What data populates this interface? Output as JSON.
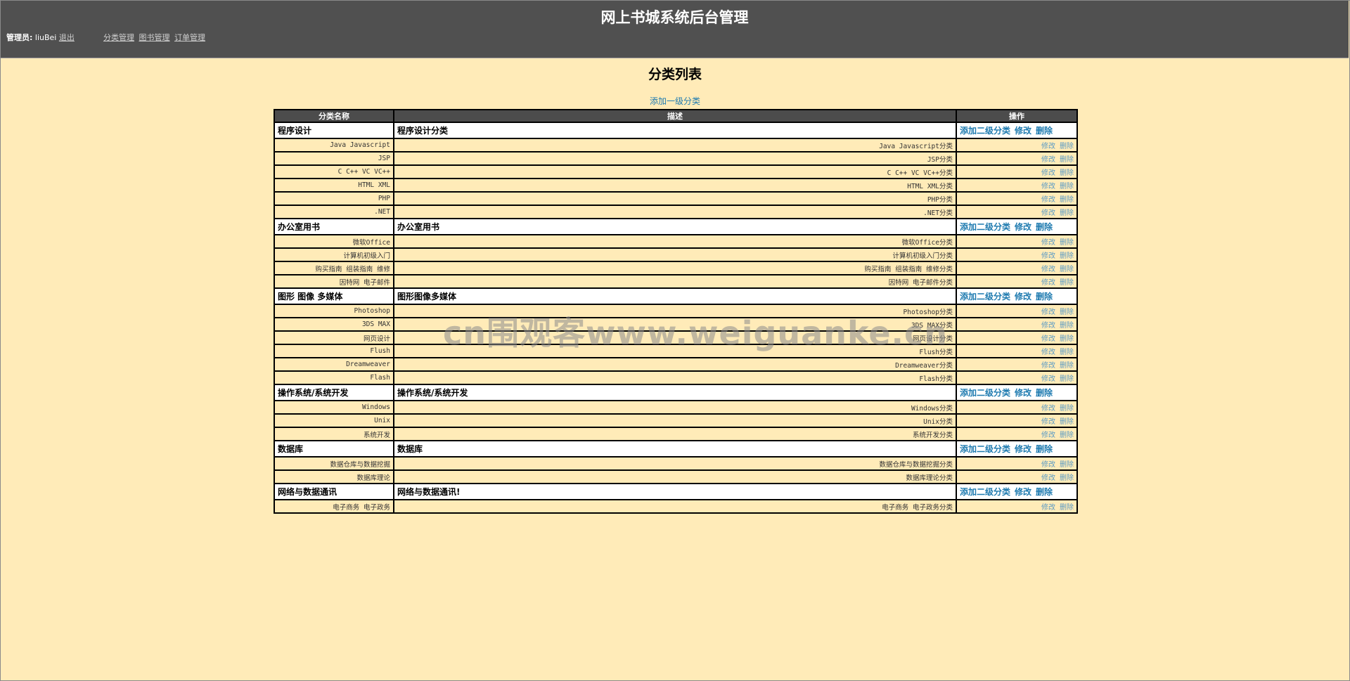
{
  "header": {
    "title": "网上书城系统后台管理",
    "admin_label": "管理员:",
    "admin_name": "liuBei",
    "logout": "退出",
    "nav": [
      "分类管理",
      "图书管理",
      "订单管理"
    ]
  },
  "page": {
    "title": "分类列表",
    "add_top": "添加一级分类"
  },
  "table": {
    "headers": [
      "分类名称",
      "描述",
      "操作"
    ],
    "ops_level1": [
      "添加二级分类",
      "修改",
      "删除"
    ],
    "ops_level2": [
      "修改",
      "删除"
    ],
    "groups": [
      {
        "name": "程序设计",
        "desc": "程序设计分类",
        "children": [
          {
            "name": "Java Javascript",
            "desc": "Java Javascript分类"
          },
          {
            "name": "JSP",
            "desc": "JSP分类"
          },
          {
            "name": "C C++ VC VC++",
            "desc": "C C++ VC VC++分类"
          },
          {
            "name": "HTML XML",
            "desc": "HTML XML分类"
          },
          {
            "name": "PHP",
            "desc": "PHP分类"
          },
          {
            "name": ".NET",
            "desc": ".NET分类"
          }
        ]
      },
      {
        "name": "办公室用书",
        "desc": "办公室用书",
        "children": [
          {
            "name": "微软Office",
            "desc": "微软Office分类"
          },
          {
            "name": "计算机初级入门",
            "desc": "计算机初级入门分类"
          },
          {
            "name": "购买指南 组装指南 维修",
            "desc": "购买指南 组装指南 维修分类"
          },
          {
            "name": "因特网 电子邮件",
            "desc": "因特网 电子邮件分类"
          }
        ]
      },
      {
        "name": "图形 图像 多媒体",
        "desc": "图形图像多媒体",
        "children": [
          {
            "name": "Photoshop",
            "desc": "Photoshop分类"
          },
          {
            "name": "3DS MAX",
            "desc": "3DS MAX分类"
          },
          {
            "name": "网页设计",
            "desc": "网页设计分类"
          },
          {
            "name": "Flush",
            "desc": "Flush分类"
          },
          {
            "name": "Dreamweaver",
            "desc": "Dreamweaver分类"
          },
          {
            "name": "Flash",
            "desc": "Flash分类"
          }
        ]
      },
      {
        "name": "操作系统/系统开发",
        "desc": "操作系统/系统开发",
        "children": [
          {
            "name": "Windows",
            "desc": "Windows分类"
          },
          {
            "name": "Unix",
            "desc": "Unix分类"
          },
          {
            "name": "系统开发",
            "desc": "系统开发分类"
          }
        ]
      },
      {
        "name": "数据库",
        "desc": "数据库",
        "children": [
          {
            "name": "数据仓库与数据挖掘",
            "desc": "数据仓库与数据挖掘分类"
          },
          {
            "name": "数据库理论",
            "desc": "数据库理论分类"
          }
        ]
      },
      {
        "name": "网络与数据通讯",
        "desc": "网络与数据通讯!",
        "children": [
          {
            "name": "电子商务 电子政务",
            "desc": "电子商务 电子政务分类"
          }
        ]
      }
    ]
  },
  "watermark": "cn围观客www.weiguanke.cn",
  "colors": {
    "background": "#ffebb8",
    "header": "#505050",
    "link": "#1f7bb0"
  }
}
